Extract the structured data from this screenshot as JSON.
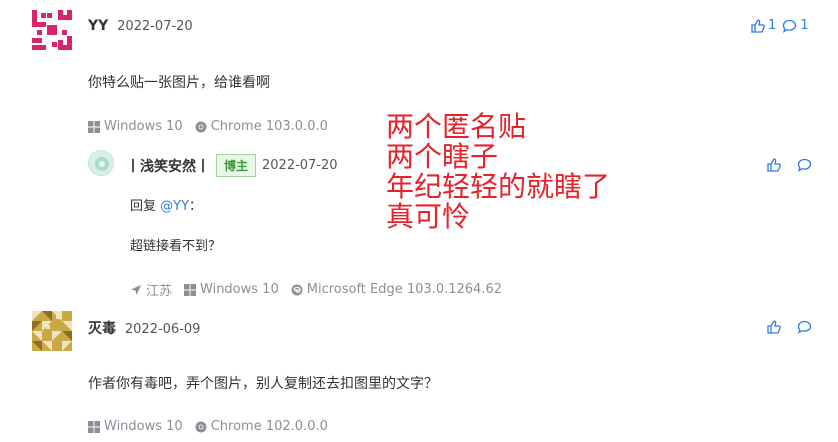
{
  "comments": [
    {
      "author": "YY",
      "date": "2022-07-20",
      "text": "你特么贴一张图片，给谁看啊",
      "os": "Windows 10",
      "browser": "Chrome 103.0.0.0",
      "likes": "1",
      "replies": "1"
    },
    {
      "author_prefix": "丨浅笑安然丨",
      "badge": "博主",
      "date": "2022-07-20",
      "reply_prefix": "回复",
      "reply_to": "@YY",
      "reply_colon": "：",
      "text": "超链接看不到？",
      "location": "江苏",
      "os": "Windows 10",
      "browser": "Microsoft Edge 103.0.1264.62"
    },
    {
      "author": "灭毒",
      "date": "2022-06-09",
      "text": "作者你有毒吧，弄个图片，别人复制还去扣图里的文字？",
      "os": "Windows 10",
      "browser": "Chrome 102.0.0.0"
    }
  ],
  "overlay_lines": [
    "两个匿名贴",
    "两个瞎子",
    "年纪轻轻的就瞎了",
    "真可怜"
  ],
  "colors": {
    "accent": "#2a7de1",
    "overlay": "#e8222b",
    "badge_green": "#3d9b3d",
    "meta_gray": "#8a8f99"
  }
}
